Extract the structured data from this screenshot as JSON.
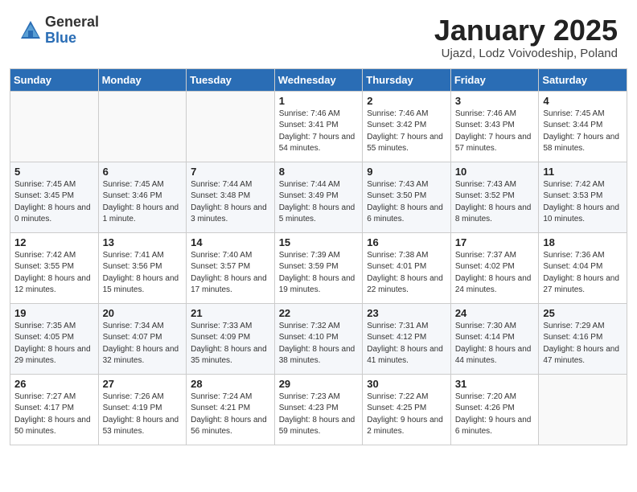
{
  "header": {
    "logo_general": "General",
    "logo_blue": "Blue",
    "month_title": "January 2025",
    "subtitle": "Ujazd, Lodz Voivodeship, Poland"
  },
  "days_of_week": [
    "Sunday",
    "Monday",
    "Tuesday",
    "Wednesday",
    "Thursday",
    "Friday",
    "Saturday"
  ],
  "weeks": [
    [
      {
        "day": "",
        "sunrise": "",
        "sunset": "",
        "daylight": ""
      },
      {
        "day": "",
        "sunrise": "",
        "sunset": "",
        "daylight": ""
      },
      {
        "day": "",
        "sunrise": "",
        "sunset": "",
        "daylight": ""
      },
      {
        "day": "1",
        "sunrise": "Sunrise: 7:46 AM",
        "sunset": "Sunset: 3:41 PM",
        "daylight": "Daylight: 7 hours and 54 minutes."
      },
      {
        "day": "2",
        "sunrise": "Sunrise: 7:46 AM",
        "sunset": "Sunset: 3:42 PM",
        "daylight": "Daylight: 7 hours and 55 minutes."
      },
      {
        "day": "3",
        "sunrise": "Sunrise: 7:46 AM",
        "sunset": "Sunset: 3:43 PM",
        "daylight": "Daylight: 7 hours and 57 minutes."
      },
      {
        "day": "4",
        "sunrise": "Sunrise: 7:45 AM",
        "sunset": "Sunset: 3:44 PM",
        "daylight": "Daylight: 7 hours and 58 minutes."
      }
    ],
    [
      {
        "day": "5",
        "sunrise": "Sunrise: 7:45 AM",
        "sunset": "Sunset: 3:45 PM",
        "daylight": "Daylight: 8 hours and 0 minutes."
      },
      {
        "day": "6",
        "sunrise": "Sunrise: 7:45 AM",
        "sunset": "Sunset: 3:46 PM",
        "daylight": "Daylight: 8 hours and 1 minute."
      },
      {
        "day": "7",
        "sunrise": "Sunrise: 7:44 AM",
        "sunset": "Sunset: 3:48 PM",
        "daylight": "Daylight: 8 hours and 3 minutes."
      },
      {
        "day": "8",
        "sunrise": "Sunrise: 7:44 AM",
        "sunset": "Sunset: 3:49 PM",
        "daylight": "Daylight: 8 hours and 5 minutes."
      },
      {
        "day": "9",
        "sunrise": "Sunrise: 7:43 AM",
        "sunset": "Sunset: 3:50 PM",
        "daylight": "Daylight: 8 hours and 6 minutes."
      },
      {
        "day": "10",
        "sunrise": "Sunrise: 7:43 AM",
        "sunset": "Sunset: 3:52 PM",
        "daylight": "Daylight: 8 hours and 8 minutes."
      },
      {
        "day": "11",
        "sunrise": "Sunrise: 7:42 AM",
        "sunset": "Sunset: 3:53 PM",
        "daylight": "Daylight: 8 hours and 10 minutes."
      }
    ],
    [
      {
        "day": "12",
        "sunrise": "Sunrise: 7:42 AM",
        "sunset": "Sunset: 3:55 PM",
        "daylight": "Daylight: 8 hours and 12 minutes."
      },
      {
        "day": "13",
        "sunrise": "Sunrise: 7:41 AM",
        "sunset": "Sunset: 3:56 PM",
        "daylight": "Daylight: 8 hours and 15 minutes."
      },
      {
        "day": "14",
        "sunrise": "Sunrise: 7:40 AM",
        "sunset": "Sunset: 3:57 PM",
        "daylight": "Daylight: 8 hours and 17 minutes."
      },
      {
        "day": "15",
        "sunrise": "Sunrise: 7:39 AM",
        "sunset": "Sunset: 3:59 PM",
        "daylight": "Daylight: 8 hours and 19 minutes."
      },
      {
        "day": "16",
        "sunrise": "Sunrise: 7:38 AM",
        "sunset": "Sunset: 4:01 PM",
        "daylight": "Daylight: 8 hours and 22 minutes."
      },
      {
        "day": "17",
        "sunrise": "Sunrise: 7:37 AM",
        "sunset": "Sunset: 4:02 PM",
        "daylight": "Daylight: 8 hours and 24 minutes."
      },
      {
        "day": "18",
        "sunrise": "Sunrise: 7:36 AM",
        "sunset": "Sunset: 4:04 PM",
        "daylight": "Daylight: 8 hours and 27 minutes."
      }
    ],
    [
      {
        "day": "19",
        "sunrise": "Sunrise: 7:35 AM",
        "sunset": "Sunset: 4:05 PM",
        "daylight": "Daylight: 8 hours and 29 minutes."
      },
      {
        "day": "20",
        "sunrise": "Sunrise: 7:34 AM",
        "sunset": "Sunset: 4:07 PM",
        "daylight": "Daylight: 8 hours and 32 minutes."
      },
      {
        "day": "21",
        "sunrise": "Sunrise: 7:33 AM",
        "sunset": "Sunset: 4:09 PM",
        "daylight": "Daylight: 8 hours and 35 minutes."
      },
      {
        "day": "22",
        "sunrise": "Sunrise: 7:32 AM",
        "sunset": "Sunset: 4:10 PM",
        "daylight": "Daylight: 8 hours and 38 minutes."
      },
      {
        "day": "23",
        "sunrise": "Sunrise: 7:31 AM",
        "sunset": "Sunset: 4:12 PM",
        "daylight": "Daylight: 8 hours and 41 minutes."
      },
      {
        "day": "24",
        "sunrise": "Sunrise: 7:30 AM",
        "sunset": "Sunset: 4:14 PM",
        "daylight": "Daylight: 8 hours and 44 minutes."
      },
      {
        "day": "25",
        "sunrise": "Sunrise: 7:29 AM",
        "sunset": "Sunset: 4:16 PM",
        "daylight": "Daylight: 8 hours and 47 minutes."
      }
    ],
    [
      {
        "day": "26",
        "sunrise": "Sunrise: 7:27 AM",
        "sunset": "Sunset: 4:17 PM",
        "daylight": "Daylight: 8 hours and 50 minutes."
      },
      {
        "day": "27",
        "sunrise": "Sunrise: 7:26 AM",
        "sunset": "Sunset: 4:19 PM",
        "daylight": "Daylight: 8 hours and 53 minutes."
      },
      {
        "day": "28",
        "sunrise": "Sunrise: 7:24 AM",
        "sunset": "Sunset: 4:21 PM",
        "daylight": "Daylight: 8 hours and 56 minutes."
      },
      {
        "day": "29",
        "sunrise": "Sunrise: 7:23 AM",
        "sunset": "Sunset: 4:23 PM",
        "daylight": "Daylight: 8 hours and 59 minutes."
      },
      {
        "day": "30",
        "sunrise": "Sunrise: 7:22 AM",
        "sunset": "Sunset: 4:25 PM",
        "daylight": "Daylight: 9 hours and 2 minutes."
      },
      {
        "day": "31",
        "sunrise": "Sunrise: 7:20 AM",
        "sunset": "Sunset: 4:26 PM",
        "daylight": "Daylight: 9 hours and 6 minutes."
      },
      {
        "day": "",
        "sunrise": "",
        "sunset": "",
        "daylight": ""
      }
    ]
  ]
}
